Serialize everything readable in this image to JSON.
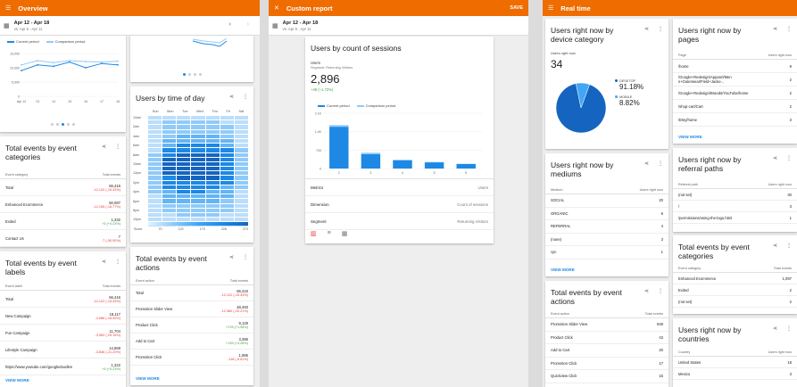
{
  "panel1": {
    "appbar": {
      "title": "Overview"
    },
    "date": {
      "range": "Apr 12 - Apr 18",
      "compare": "vs. Apr 5 - Apr 11"
    },
    "chart": {
      "legend_current": "Current period",
      "legend_comparison": "Comparison period",
      "yticks": [
        "15,000",
        "10,000",
        "5,000",
        "0"
      ],
      "xticks": [
        "Apr 12",
        "13",
        "14",
        "15",
        "16",
        "17",
        "18"
      ],
      "chart_data": {
        "type": "line",
        "categories": [
          "Apr 12",
          "13",
          "14",
          "15",
          "16",
          "17",
          "18"
        ],
        "series": [
          {
            "name": "Current period",
            "values": [
              9000,
              11000,
              10500,
              12000,
              10000,
              11500,
              11000
            ]
          },
          {
            "name": "Comparison period",
            "values": [
              11000,
              12500,
              11800,
              12500,
              12200,
              12000,
              12300
            ]
          }
        ],
        "ylim": [
          0,
          15000
        ]
      }
    },
    "events_categories": {
      "title": "Total events by event categories",
      "col1": "Event category",
      "col2": "Total events",
      "rows": [
        {
          "label": "Total",
          "value": "66,416",
          "delta": "-12,122 (-15.43%)",
          "dir": "down"
        },
        {
          "label": "Enhanced Ecommerce",
          "value": "60,087",
          "delta": "-12,155 (-16.77%)",
          "dir": "down"
        },
        {
          "label": "Exited",
          "value": "1,332",
          "delta": "+3 (+0.23%)",
          "dir": "up"
        },
        {
          "label": "Contact Us",
          "value": "7",
          "delta": "-7 (-50.00%)",
          "dir": "down"
        }
      ]
    },
    "events_labels": {
      "title": "Total events by event labels",
      "col1": "Event label",
      "col2": "Total events",
      "rows": [
        {
          "label": "Total",
          "value": "66,416",
          "delta": "-12,122 (-15.43%)",
          "dir": "down"
        },
        {
          "label": "New Campaign",
          "value": "18,117",
          "delta": "-4,086 (-18.40%)",
          "dir": "down"
        },
        {
          "label": "Fun Campaign",
          "value": "11,704",
          "delta": "-3,962 (-25.15%)",
          "dir": "down"
        },
        {
          "label": "Lifestyle Campaign",
          "value": "14,669",
          "delta": "-3,846 (-21.20%)",
          "dir": "down"
        },
        {
          "label": "https://www.youtube.com/googledoodles",
          "value": "1,322",
          "delta": "+3 (+0.23%)",
          "dir": "up"
        }
      ],
      "view_more": "VIEW MORE"
    },
    "time_of_day": {
      "title": "Users by time of day",
      "days": [
        "Sun",
        "Mon",
        "Tue",
        "Wed",
        "Thu",
        "Fri",
        "Sat"
      ],
      "hours": [
        "12am",
        "2am",
        "4am",
        "6am",
        "8am",
        "10am",
        "12pm",
        "2pm",
        "4pm",
        "6pm",
        "8pm",
        "10pm"
      ],
      "scale": [
        "Score",
        "70",
        "122",
        "170",
        "226",
        "270"
      ],
      "chart_data": {
        "type": "heatmap",
        "columns": [
          "Sun",
          "Mon",
          "Tue",
          "Wed",
          "Thu",
          "Fri",
          "Sat"
        ],
        "rows": [
          "12am",
          "1am",
          "2am",
          "3am",
          "4am",
          "5am",
          "6am",
          "7am",
          "8am",
          "9am",
          "10am",
          "11am",
          "12pm",
          "1pm",
          "2pm",
          "3pm",
          "4pm",
          "5pm",
          "6pm",
          "7pm",
          "8pm",
          "9pm",
          "10pm",
          "11pm"
        ],
        "values": [
          [
            1,
            1,
            1,
            1,
            1,
            1,
            1
          ],
          [
            1,
            2,
            2,
            2,
            2,
            1,
            1
          ],
          [
            1,
            2,
            2,
            2,
            2,
            2,
            1
          ],
          [
            1,
            2,
            2,
            2,
            2,
            2,
            1
          ],
          [
            1,
            2,
            3,
            3,
            3,
            2,
            1
          ],
          [
            1,
            3,
            3,
            3,
            3,
            3,
            1
          ],
          [
            1,
            3,
            4,
            4,
            4,
            3,
            1
          ],
          [
            1,
            4,
            4,
            4,
            4,
            4,
            2
          ],
          [
            2,
            4,
            5,
            5,
            5,
            4,
            2
          ],
          [
            2,
            5,
            5,
            5,
            5,
            4,
            2
          ],
          [
            2,
            5,
            5,
            5,
            5,
            4,
            2
          ],
          [
            2,
            5,
            5,
            5,
            5,
            4,
            2
          ],
          [
            2,
            5,
            5,
            5,
            5,
            4,
            2
          ],
          [
            2,
            4,
            5,
            5,
            5,
            4,
            2
          ],
          [
            2,
            4,
            4,
            4,
            4,
            4,
            2
          ],
          [
            2,
            4,
            4,
            4,
            4,
            3,
            2
          ],
          [
            2,
            3,
            4,
            4,
            3,
            3,
            1
          ],
          [
            1,
            3,
            3,
            3,
            3,
            3,
            1
          ],
          [
            1,
            3,
            3,
            3,
            3,
            2,
            1
          ],
          [
            1,
            2,
            2,
            2,
            2,
            2,
            1
          ],
          [
            1,
            2,
            2,
            2,
            2,
            2,
            1
          ],
          [
            1,
            1,
            2,
            2,
            2,
            1,
            1
          ],
          [
            1,
            1,
            1,
            1,
            1,
            1,
            1
          ],
          [
            1,
            1,
            1,
            1,
            1,
            1,
            1
          ]
        ]
      }
    },
    "events_actions": {
      "title": "Total events by event actions",
      "col1": "Event action",
      "col2": "Total events",
      "rows": [
        {
          "label": "Total",
          "value": "66,416",
          "delta": "-12,122 (-15.43%)",
          "dir": "down"
        },
        {
          "label": "Promotion Slider View",
          "value": "48,493",
          "delta": "-12,380 (-20.21%)",
          "dir": "down"
        },
        {
          "label": "Product Click",
          "value": "9,129",
          "delta": "+178 (+1.98%)",
          "dir": "up"
        },
        {
          "label": "Add to Cart",
          "value": "3,386",
          "delta": "+139 (+4.28%)",
          "dir": "up"
        },
        {
          "label": "Promotion Click",
          "value": "1,985",
          "delta": "-118 (-5.61%)",
          "dir": "down"
        }
      ],
      "view_more": "VIEW MORE"
    }
  },
  "panel2": {
    "appbar": {
      "title": "Custom report",
      "save": "SAVE"
    },
    "date": {
      "range": "Apr 12 - Apr 18",
      "compare": "vs. Apr 5 - Apr 11"
    },
    "card": {
      "title": "Users by count of sessions",
      "metric": "Users",
      "segment_line": "Segment: Returning Visitors",
      "value": "2,896",
      "delta": "+48 (+1.72%)",
      "legend_current": "Current period",
      "legend_comparison": "Comparison period",
      "yticks": [
        "2.1K",
        "1.4K",
        "700",
        "0"
      ],
      "xticks": [
        "2",
        "3",
        "4",
        "5",
        "6"
      ],
      "chart_data": {
        "type": "bar",
        "categories": [
          "2",
          "3",
          "4",
          "5",
          "6"
        ],
        "series": [
          {
            "name": "Current period",
            "values": [
              1580,
              540,
              310,
              230,
              170
            ]
          },
          {
            "name": "Comparison period",
            "values": [
              1650,
              600,
              330,
              250,
              180
            ]
          }
        ],
        "ylim": [
          0,
          2100
        ]
      },
      "settings": [
        {
          "label": "Metrics",
          "value": "Users"
        },
        {
          "label": "Dimension",
          "value": "Count of sessions"
        },
        {
          "label": "Segment",
          "value": "Returning Visitors"
        }
      ]
    }
  },
  "panel3": {
    "appbar": {
      "title": "Real time"
    },
    "device": {
      "title": "Users right now by device category",
      "sub": "Users right now",
      "value": "34",
      "legend": [
        {
          "label": "DESKTOP",
          "value": "91.18%",
          "color": "#1565c0"
        },
        {
          "label": "MOBILE",
          "value": "8.82%",
          "color": "#42a5f5"
        }
      ],
      "chart_data": {
        "type": "pie",
        "categories": [
          "DESKTOP",
          "MOBILE"
        ],
        "values": [
          91.18,
          8.82
        ]
      }
    },
    "pages": {
      "title": "Users right now by pages",
      "col1": "Page",
      "col2": "Users right now",
      "rows": [
        {
          "label": "/home",
          "value": "9"
        },
        {
          "label": "/Google+Redesign/Apparel/Men s+Outerwear/Field+Jacke...",
          "value": "2"
        },
        {
          "label": "/Google+Redesign/Brands/YouTube/home",
          "value": "2"
        },
        {
          "label": "/shop-cart/Cart",
          "value": "2"
        },
        {
          "label": "/Etsy/home",
          "value": "3"
        }
      ],
      "view_more": "VIEW MORE"
    },
    "mediums": {
      "title": "Users right now by mediums",
      "col1": "Medium",
      "col2": "Users right now",
      "rows": [
        {
          "label": "SOCIAL",
          "value": "20"
        },
        {
          "label": "ORGANIC",
          "value": "6"
        },
        {
          "label": "REFERRAL",
          "value": "4"
        },
        {
          "label": "(none)",
          "value": "3"
        },
        {
          "label": "cpc",
          "value": "1"
        }
      ],
      "view_more": "VIEW MORE"
    },
    "referral": {
      "title": "Users right now by referral paths",
      "col1": "Referral path",
      "col2": "Users right now",
      "rows": [
        {
          "label": "(not set)",
          "value": "30"
        },
        {
          "label": "/",
          "value": "3"
        },
        {
          "label": "/permissions/using-the-logo.html",
          "value": "1"
        }
      ]
    },
    "rt_actions": {
      "title": "Total events by event actions",
      "col1": "Event action",
      "col2": "Total events",
      "rows": [
        {
          "label": "Promotion Slider View",
          "value": "949"
        },
        {
          "label": "Product Click",
          "value": "43"
        },
        {
          "label": "Add to Cart",
          "value": "20"
        },
        {
          "label": "Promotion Click",
          "value": "17"
        },
        {
          "label": "Quickview Click",
          "value": "15"
        }
      ]
    },
    "rt_categories": {
      "title": "Total events by event categories",
      "col1": "Event category",
      "col2": "Total events",
      "rows": [
        {
          "label": "Enhanced Ecommerce",
          "value": "1,097"
        },
        {
          "label": "Exited",
          "value": "2"
        },
        {
          "label": "(not set)",
          "value": "2"
        }
      ]
    },
    "countries": {
      "title": "Users right now by countries",
      "col1": "Country",
      "col2": "Users right now",
      "rows": [
        {
          "label": "United States",
          "value": "18"
        },
        {
          "label": "Mexico",
          "value": "3"
        }
      ]
    }
  }
}
